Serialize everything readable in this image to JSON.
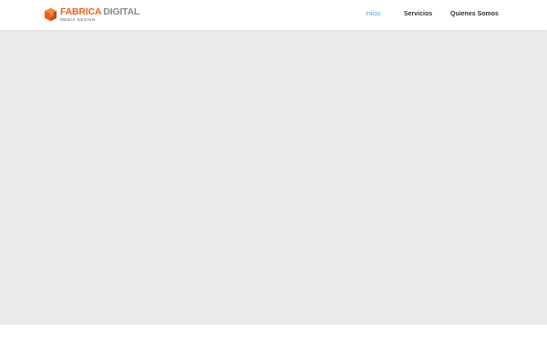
{
  "brand": {
    "name_part1": "FABRICA",
    "name_part2": "DIGITAL",
    "tagline": "MEDIA DESIGN",
    "colors": {
      "primary": "#e8601c",
      "secondary": "#8a8a8a"
    }
  },
  "nav": {
    "items": [
      {
        "label": "Inicio",
        "active": true
      },
      {
        "label": "Servicios",
        "active": false
      },
      {
        "label": "Quienes Somos",
        "active": false
      }
    ],
    "active_color": "#41a9e0",
    "color": "#333333"
  },
  "hero": {
    "background": "#ebebeb"
  }
}
